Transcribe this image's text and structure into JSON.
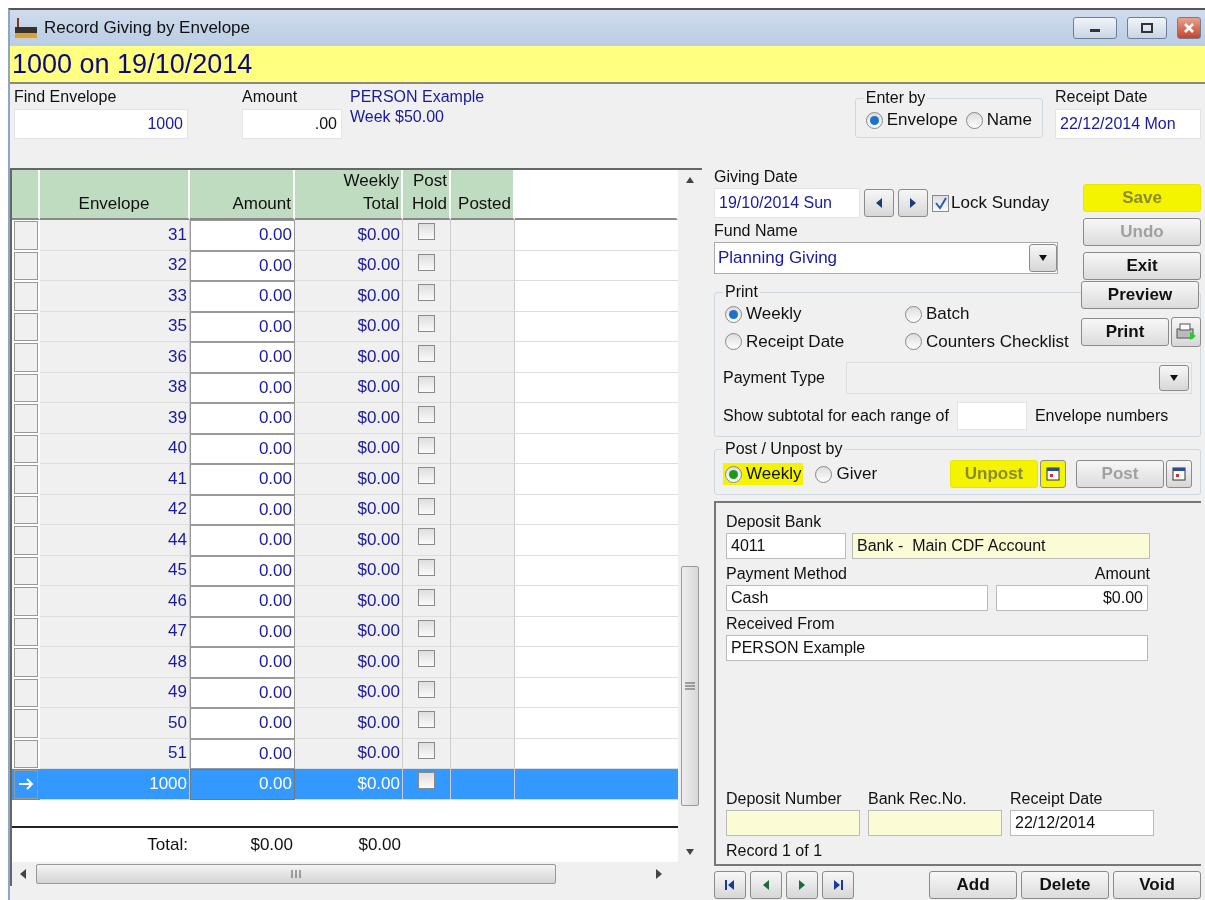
{
  "window": {
    "title": "Record Giving by Envelope"
  },
  "banner": "1000 on 19/10/2014",
  "find_envelope": {
    "label": "Find Envelope",
    "value": "1000"
  },
  "amount": {
    "label": "Amount",
    "value": ".00"
  },
  "giver_info": [
    "PERSON Example",
    "Week $50.00"
  ],
  "enter_by": {
    "label": "Enter by",
    "options": [
      {
        "label": "Envelope",
        "selected": true
      },
      {
        "label": "Name",
        "selected": false
      }
    ]
  },
  "receipt_date": {
    "label": "Receipt Date",
    "value": "22/12/2014 Mon"
  },
  "grid": {
    "columns": [
      {
        "lines": [
          "Envelope"
        ]
      },
      {
        "lines": [
          "Amount"
        ]
      },
      {
        "lines": [
          "Weekly",
          "Total"
        ]
      },
      {
        "lines": [
          "Post",
          "Hold"
        ]
      },
      {
        "lines": [
          "Posted"
        ]
      }
    ],
    "rows": [
      {
        "envelope": "31",
        "amount": "0.00",
        "weekly_total": "$0.00",
        "post_hold": false,
        "selected": false
      },
      {
        "envelope": "32",
        "amount": "0.00",
        "weekly_total": "$0.00",
        "post_hold": false,
        "selected": false
      },
      {
        "envelope": "33",
        "amount": "0.00",
        "weekly_total": "$0.00",
        "post_hold": false,
        "selected": false
      },
      {
        "envelope": "35",
        "amount": "0.00",
        "weekly_total": "$0.00",
        "post_hold": false,
        "selected": false
      },
      {
        "envelope": "36",
        "amount": "0.00",
        "weekly_total": "$0.00",
        "post_hold": false,
        "selected": false
      },
      {
        "envelope": "38",
        "amount": "0.00",
        "weekly_total": "$0.00",
        "post_hold": false,
        "selected": false
      },
      {
        "envelope": "39",
        "amount": "0.00",
        "weekly_total": "$0.00",
        "post_hold": false,
        "selected": false
      },
      {
        "envelope": "40",
        "amount": "0.00",
        "weekly_total": "$0.00",
        "post_hold": false,
        "selected": false
      },
      {
        "envelope": "41",
        "amount": "0.00",
        "weekly_total": "$0.00",
        "post_hold": false,
        "selected": false
      },
      {
        "envelope": "42",
        "amount": "0.00",
        "weekly_total": "$0.00",
        "post_hold": false,
        "selected": false
      },
      {
        "envelope": "44",
        "amount": "0.00",
        "weekly_total": "$0.00",
        "post_hold": false,
        "selected": false
      },
      {
        "envelope": "45",
        "amount": "0.00",
        "weekly_total": "$0.00",
        "post_hold": false,
        "selected": false
      },
      {
        "envelope": "46",
        "amount": "0.00",
        "weekly_total": "$0.00",
        "post_hold": false,
        "selected": false
      },
      {
        "envelope": "47",
        "amount": "0.00",
        "weekly_total": "$0.00",
        "post_hold": false,
        "selected": false
      },
      {
        "envelope": "48",
        "amount": "0.00",
        "weekly_total": "$0.00",
        "post_hold": false,
        "selected": false
      },
      {
        "envelope": "49",
        "amount": "0.00",
        "weekly_total": "$0.00",
        "post_hold": false,
        "selected": false
      },
      {
        "envelope": "50",
        "amount": "0.00",
        "weekly_total": "$0.00",
        "post_hold": false,
        "selected": false
      },
      {
        "envelope": "51",
        "amount": "0.00",
        "weekly_total": "$0.00",
        "post_hold": false,
        "selected": false
      },
      {
        "envelope": "1000",
        "amount": "0.00",
        "weekly_total": "$0.00",
        "post_hold": false,
        "selected": true
      }
    ],
    "total": {
      "label": "Total:",
      "amount": "$0.00",
      "weekly_total": "$0.00"
    }
  },
  "giving_date": {
    "label": "Giving Date",
    "value": "19/10/2014 Sun"
  },
  "lock_sunday": {
    "label": "Lock Sunday",
    "checked": true
  },
  "fund_name": {
    "label": "Fund Name",
    "value": "Planning Giving"
  },
  "side_buttons": [
    {
      "label": "Save",
      "disabled": true,
      "highlighted": true
    },
    {
      "label": "Undo",
      "disabled": true,
      "highlighted": false
    },
    {
      "label": "Exit",
      "disabled": false,
      "highlighted": false
    }
  ],
  "print": {
    "label": "Print",
    "options": [
      {
        "label": "Weekly",
        "selected": true
      },
      {
        "label": "Batch",
        "selected": false
      },
      {
        "label": "Receipt Date",
        "selected": false
      },
      {
        "label": "Counters Checklist",
        "selected": false
      }
    ],
    "payment_type": {
      "label": "Payment Type"
    },
    "subtotal": {
      "label": "Show subtotal for each range of",
      "suffix": "Envelope numbers"
    },
    "buttons": [
      {
        "label": "Preview"
      },
      {
        "label": "Print"
      }
    ]
  },
  "post_unpost": {
    "label": "Post / Unpost by",
    "options": [
      {
        "label": "Weekly",
        "selected": true,
        "highlighted": true
      },
      {
        "label": "Giver",
        "selected": false,
        "highlighted": false
      }
    ],
    "buttons": [
      {
        "label": "Unpost",
        "disabled": true,
        "highlighted": true
      },
      {
        "label": "Post",
        "disabled": true,
        "highlighted": false
      }
    ]
  },
  "deposit": {
    "bank_label": "Deposit Bank",
    "bank_code": "4011",
    "bank_name": "Bank -  Main CDF Account",
    "method_label": "Payment Method",
    "method": "Cash",
    "amount_label": "Amount",
    "amount": "$0.00",
    "received_label": "Received From",
    "received": "PERSON Example",
    "number_label": "Deposit Number",
    "bank_rec_label": "Bank Rec.No.",
    "receipt_date_label": "Receipt Date",
    "receipt_date": "22/12/2014",
    "status": "Record 1 of 1"
  },
  "bottom_buttons": [
    {
      "label": "Add"
    },
    {
      "label": "Delete"
    },
    {
      "label": "Void"
    }
  ]
}
